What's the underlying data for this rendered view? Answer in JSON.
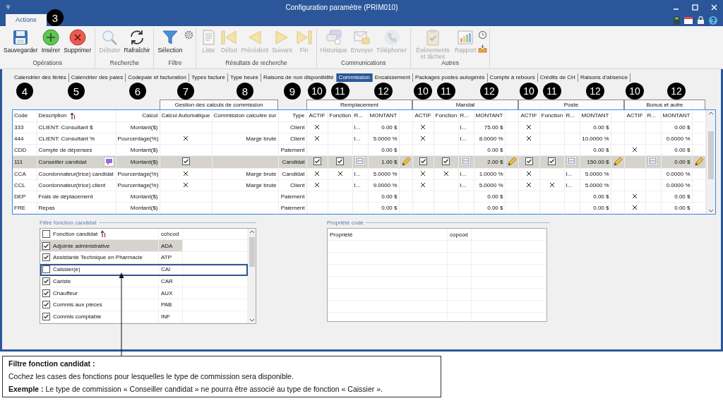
{
  "window": {
    "title": "Configuration paramètre (PRIM010)"
  },
  "ribbon_tabs": [
    {
      "label": "Actions",
      "selected": true,
      "marker": "3"
    }
  ],
  "ribbon": {
    "groups": [
      {
        "label": "Opérations",
        "buttons": [
          {
            "kind": "save",
            "label": "Sauvegarder",
            "disabled": false
          },
          {
            "kind": "insert",
            "label": "Insérer",
            "disabled": false
          },
          {
            "kind": "delete",
            "label": "Supprimer",
            "disabled": false
          }
        ]
      },
      {
        "label": "Recherche",
        "buttons": [
          {
            "kind": "search",
            "label": "Débuter",
            "disabled": true
          },
          {
            "kind": "refresh",
            "label": "Rafraîchir",
            "disabled": false
          }
        ]
      },
      {
        "label": "Filtre",
        "buttons": [
          {
            "kind": "filter",
            "label": "Sélection",
            "disabled": false
          },
          {
            "kind": "gear"
          }
        ]
      },
      {
        "label": "Résultats de recherche",
        "buttons": [
          {
            "kind": "list",
            "label": "Liste",
            "disabled": true
          },
          {
            "kind": "first",
            "label": "Début",
            "disabled": true
          },
          {
            "kind": "prev",
            "label": "Précédent",
            "disabled": true
          },
          {
            "kind": "next",
            "label": "Suivant",
            "disabled": true
          },
          {
            "kind": "last",
            "label": "Fin",
            "disabled": true
          }
        ]
      },
      {
        "label": "Communications",
        "buttons": [
          {
            "kind": "history",
            "label": "Historique",
            "disabled": true
          },
          {
            "kind": "send",
            "label": "Envoyer",
            "disabled": true
          },
          {
            "kind": "phone",
            "label": "Téléphoner",
            "disabled": true
          }
        ]
      },
      {
        "label": "Autres",
        "buttons": [
          {
            "kind": "events",
            "label": "Événements et tâches",
            "disabled": true
          },
          {
            "kind": "report",
            "label": "Rapport",
            "disabled": true
          },
          {
            "kind": "clock"
          },
          {
            "kind": "inbox"
          }
        ]
      }
    ]
  },
  "tabs": [
    {
      "label": "Calendrier des fériés",
      "selected": false
    },
    {
      "label": "Calendrier des paies",
      "selected": false
    },
    {
      "label": "Codepaie et facturation",
      "selected": false
    },
    {
      "label": "Types facture",
      "selected": false
    },
    {
      "label": "Type heure",
      "selected": false
    },
    {
      "label": "Raisons de non disponibilité",
      "selected": false
    },
    {
      "label": "Commission",
      "selected": true
    },
    {
      "label": "Encaissement",
      "selected": false
    },
    {
      "label": "Packages postes autogérés",
      "selected": false
    },
    {
      "label": "Compte à rebours",
      "selected": false
    },
    {
      "label": "Crédits de CH",
      "selected": false
    },
    {
      "label": "Raisons d'absence",
      "selected": false
    }
  ],
  "table": {
    "header_group": {
      "title": "Gestion des calculs de commission"
    },
    "columns": [
      {
        "kind": "code",
        "label": "Code",
        "marker": "4",
        "sorted": false
      },
      {
        "kind": "description",
        "label": "Description",
        "marker": "5",
        "sorted": true
      },
      {
        "kind": "calcul",
        "label": "Calcul",
        "marker": "6",
        "sorted": false
      },
      {
        "kind": "auto",
        "label": "Calcul Automatique",
        "marker": "7",
        "sorted": false
      },
      {
        "kind": "base",
        "label": "Commission calculée sur",
        "marker": "8",
        "sorted": false
      },
      {
        "kind": "type",
        "label": "Type",
        "marker": "9",
        "sorted": false
      }
    ],
    "groups": [
      {
        "title": "Remplacement",
        "columns": [
          {
            "kind": "actif",
            "label": "ACTIF",
            "marker": "10"
          },
          {
            "kind": "fonction",
            "label": "Fonction",
            "marker": "11"
          },
          {
            "kind": "r",
            "label": "R..."
          },
          {
            "kind": "montant",
            "label": "MONTANT",
            "marker": "12"
          },
          {
            "kind": "edit"
          }
        ]
      },
      {
        "title": "Mandat",
        "columns": [
          {
            "kind": "actif",
            "label": "ACTIF",
            "marker": "10"
          },
          {
            "kind": "fonction",
            "label": "Fonction",
            "marker": "11"
          },
          {
            "kind": "r",
            "label": "R..."
          },
          {
            "kind": "montant",
            "label": "MONTANT",
            "marker": "12"
          },
          {
            "kind": "edit"
          }
        ]
      },
      {
        "title": "Poste",
        "columns": [
          {
            "kind": "actif",
            "label": "ACTIF",
            "marker": "10"
          },
          {
            "kind": "fonction",
            "label": "Fonction",
            "marker": "11"
          },
          {
            "kind": "r",
            "label": "R..."
          },
          {
            "kind": "montant",
            "label": "MONTANT",
            "marker": "12"
          },
          {
            "kind": "edit"
          }
        ]
      },
      {
        "title": "Bonus et autre",
        "columns": [
          {
            "kind": "actif",
            "label": "ACTIF",
            "marker": "10"
          },
          {
            "kind": "r",
            "label": "R..."
          },
          {
            "kind": "montant",
            "label": "MONTANT",
            "marker": "12"
          },
          {
            "kind": "edit"
          }
        ]
      }
    ],
    "rows": [
      {
        "code": "333",
        "description": "CLIENT: Consultant $",
        "calcul": "Montant($)",
        "auto": false,
        "type": "Client",
        "selected": false,
        "groups": [
          {
            "actif": true,
            "fonction": false,
            "r": "I...",
            "montant": "0.00 $"
          },
          {
            "actif": true,
            "fonction": false,
            "r": "I...",
            "montant": "75.00 $"
          },
          {
            "actif": true,
            "fonction": false,
            "montant": "0.00 $"
          },
          {
            "actif": false,
            "montant": "0.00 $"
          }
        ]
      },
      {
        "code": "444",
        "description": "CLIENT: Consultant %",
        "calcul": "Pourcentage(%)",
        "auto": true,
        "base": "Marge brute",
        "type": "Client",
        "selected": false,
        "groups": [
          {
            "actif": true,
            "fonction": false,
            "r": "I...",
            "montant": "5.0000 %"
          },
          {
            "actif": true,
            "fonction": false,
            "r": "I...",
            "montant": "8.0000 %"
          },
          {
            "actif": true,
            "fonction": false,
            "montant": "10.0000 %"
          },
          {
            "actif": false,
            "montant": "0.0000 %"
          }
        ]
      },
      {
        "code": "CDD",
        "description": "Compte de dépenses",
        "calcul": "Montant($)",
        "auto": false,
        "type": "Paiement",
        "selected": false,
        "groups": [
          {
            "actif": false,
            "fonction": false,
            "montant": "0.00 $"
          },
          {
            "actif": false,
            "fonction": false,
            "montant": "0.00 $"
          },
          {
            "actif": false,
            "fonction": false,
            "montant": "0.00 $"
          },
          {
            "actif": true,
            "montant": "0.00 $"
          }
        ]
      },
      {
        "code": "111",
        "description": "Conseiller candidat",
        "calcul": "Montant($)",
        "auto": true,
        "type": "Candidat",
        "selected": true,
        "groups": [
          {
            "actif": true,
            "fonction": true,
            "montant": "1.00 $"
          },
          {
            "actif": true,
            "fonction": true,
            "montant": "2.00 $"
          },
          {
            "actif": true,
            "fonction": true,
            "montant": "150.00 $"
          },
          {
            "actif": false,
            "montant": "0.00 $"
          }
        ]
      },
      {
        "code": "CCA",
        "description": "Coordonnateur(trice) candidat",
        "calcul": "Pourcentage(%)",
        "auto": true,
        "base": "Marge brute",
        "type": "Candidat",
        "selected": false,
        "groups": [
          {
            "actif": true,
            "fonction": true,
            "r": "I...",
            "montant": "5.0000 %"
          },
          {
            "actif": true,
            "fonction": true,
            "r": "I...",
            "montant": "1.0000 %"
          },
          {
            "actif": true,
            "fonction": false,
            "r": "I...",
            "montant": "5.0000 %"
          },
          {
            "actif": false,
            "montant": "0.0000 %"
          }
        ]
      },
      {
        "code": "CCL",
        "description": "Coordonnateur(trice) client",
        "calcul": "Pourcentage(%)",
        "auto": true,
        "base": "Marge brute",
        "type": "Client",
        "selected": false,
        "groups": [
          {
            "actif": true,
            "fonction": false,
            "r": "I...",
            "montant": "9.0000 %"
          },
          {
            "actif": true,
            "fonction": false,
            "r": "I...",
            "montant": "5.0000 %"
          },
          {
            "actif": true,
            "fonction": true,
            "r": "I...",
            "montant": "5.0000 %"
          },
          {
            "actif": false,
            "montant": "0.0000 %"
          }
        ]
      },
      {
        "code": "DEP",
        "description": "Frais de déplacement",
        "calcul": "Montant($)",
        "auto": false,
        "type": "Paiement",
        "selected": false,
        "groups": [
          {
            "actif": false,
            "fonction": false,
            "montant": "0.00 $"
          },
          {
            "actif": false,
            "fonction": false,
            "montant": "0.00 $"
          },
          {
            "actif": false,
            "fonction": false,
            "montant": "0.00 $"
          },
          {
            "actif": true,
            "montant": "0.00 $"
          }
        ]
      },
      {
        "code": "FRE",
        "description": "Repas",
        "calcul": "Montant($)",
        "auto": false,
        "type": "Paiement",
        "selected": false,
        "groups": [
          {
            "actif": false,
            "fonction": false,
            "montant": "0.00 $"
          },
          {
            "actif": false,
            "fonction": false,
            "montant": "0.00 $"
          },
          {
            "actif": false,
            "fonction": false,
            "montant": "0.00 $"
          },
          {
            "actif": true,
            "montant": "0.00 $"
          }
        ]
      }
    ]
  },
  "function_filter": {
    "title": "Filtre fonction candidat",
    "all_checked": false,
    "columns": [
      {
        "label": "Fonction candidat",
        "sorted": true
      },
      {
        "label": "cchcod",
        "sorted": false
      }
    ],
    "items": [
      {
        "label": "Adjointe administrative",
        "code": "ADA",
        "checked": true,
        "selected": true,
        "outlined": false
      },
      {
        "label": "Assistante Technique en Pharmacie",
        "code": "ATP",
        "checked": true,
        "selected": false,
        "outlined": false
      },
      {
        "label": "Caissier(e)",
        "code": "CAI",
        "checked": false,
        "selected": false,
        "outlined": true
      },
      {
        "label": "Cariste",
        "code": "CAR",
        "checked": true,
        "selected": false,
        "outlined": false
      },
      {
        "label": "Chauffeur",
        "code": "AUX",
        "checked": true,
        "selected": false,
        "outlined": false
      },
      {
        "label": "Commis aux pièces",
        "code": "PAB",
        "checked": true,
        "selected": false,
        "outlined": false
      },
      {
        "label": "Commis comptable",
        "code": "INF",
        "checked": true,
        "selected": false,
        "outlined": false
      }
    ]
  },
  "property_panel": {
    "title": "Propriété code",
    "columns": [
      "Propriété",
      "copcod"
    ]
  },
  "callout": {
    "title": "Filtre fonction candidat :",
    "lines": [
      "Cochez les cases des fonctions pour lesquelles le type de commission sera disponible.",
      "**Exemple :** Le type de commission « Conseiller candidat » ne pourra être associé au type de fonction « Caissier »."
    ]
  }
}
